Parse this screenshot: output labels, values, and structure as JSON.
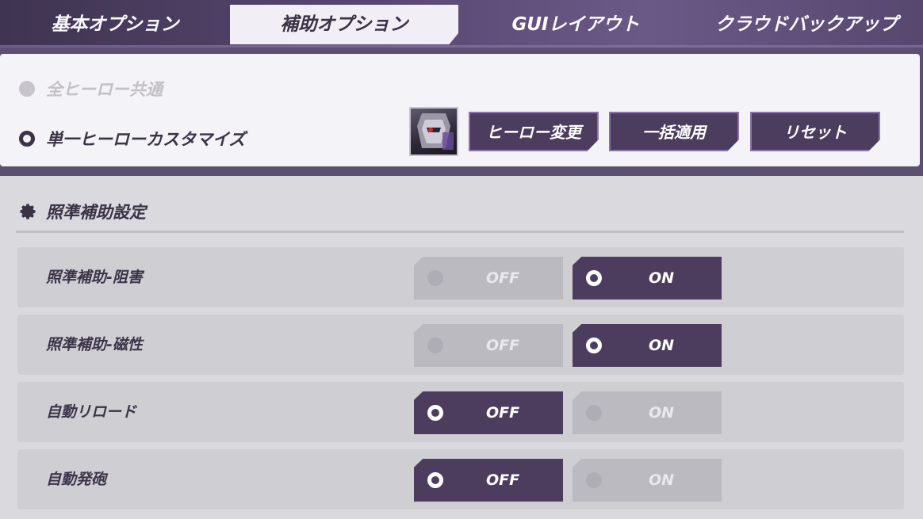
{
  "tabs": [
    {
      "label": "基本オプション",
      "active": false
    },
    {
      "label": "補助オプション",
      "active": true
    },
    {
      "label": "GUIレイアウト",
      "active": false
    },
    {
      "label": "クラウドバックアップ",
      "active": false
    }
  ],
  "hero": {
    "mode_common": "全ヒーロー共通",
    "mode_single": "単一ヒーローカスタマイズ",
    "selected_mode": "single",
    "buttons": {
      "change_hero": "ヒーロー変更",
      "apply_all": "一括適用",
      "reset": "リセット"
    }
  },
  "section": {
    "icon": "gear-icon",
    "title": "照準補助設定"
  },
  "toggle_labels": {
    "off": "OFF",
    "on": "ON"
  },
  "settings": [
    {
      "label": "照準補助-阻害",
      "value": "ON"
    },
    {
      "label": "照準補助-磁性",
      "value": "ON"
    },
    {
      "label": "自動リロード",
      "value": "OFF"
    },
    {
      "label": "自動発砲",
      "value": "OFF"
    }
  ],
  "colors": {
    "accent": "#4c3d5f",
    "panel": "#f4f3f7",
    "row": "#cfced3"
  }
}
